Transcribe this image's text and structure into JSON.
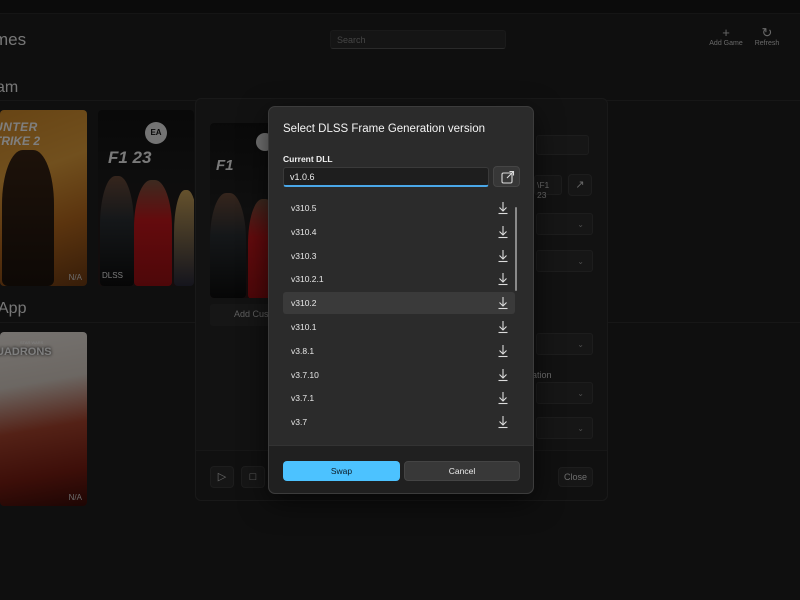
{
  "header": {
    "title": "mes",
    "search_placeholder": "Search",
    "add_game_label": "Add Game",
    "refresh_label": "Refresh"
  },
  "sections": [
    {
      "title": "am"
    },
    {
      "title": "App"
    }
  ],
  "library": {
    "cs2": {
      "line1": "UNTER",
      "line2": "TRIKE 2",
      "status": "N/A"
    },
    "f1": {
      "logo": "F1 23",
      "ea": "EA",
      "tag": "DLSS"
    },
    "starwars": {
      "title": "UADRONS",
      "subtitle": "STAR WARS",
      "status": "N/A"
    }
  },
  "details_panel": {
    "cover_logo": "F1",
    "add_custom_label": "Add Cust",
    "path_fragment": "\\F1 23",
    "generation_fragment": "eration",
    "close_label": "Close",
    "play_icon": "play-icon",
    "sticker_icon": "note-icon"
  },
  "dialog": {
    "title": "Select DLSS Frame Generation version",
    "current_dll_label": "Current DLL",
    "current_dll_value": "v1.0.6",
    "versions": [
      "v310.5",
      "v310.4",
      "v310.3",
      "v310.2.1",
      "v310.2",
      "v310.1",
      "v3.8.1",
      "v3.7.10",
      "v3.7.1",
      "v3.7"
    ],
    "selected_version": "v310.2",
    "swap_label": "Swap",
    "cancel_label": "Cancel",
    "accent_color": "#4cc2ff"
  }
}
